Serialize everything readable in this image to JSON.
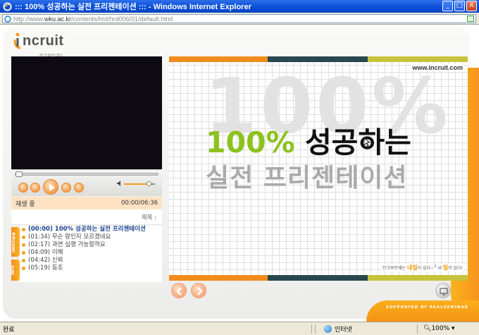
{
  "window": {
    "title": ":::  100% 성공하는 실전 프리젠테이션  ::: - Windows Internet Explorer",
    "buttons": [
      "_",
      "□",
      "X"
    ]
  },
  "address": {
    "prefix": "http://www.",
    "host": "wku.ac.kr",
    "path": "/contents/hrd/hrd006/01/default.html"
  },
  "logo": {
    "word": "ncruit",
    "sub": "인크루트(주)"
  },
  "player": {
    "status_label": "재생 중",
    "time": "00:00/06:36",
    "title_label": "제목 :",
    "seek_fraction": 0.0,
    "volume_fraction": 0.8,
    "tabs": [
      "INDEX/목록",
      "INFO"
    ],
    "index": [
      {
        "text": "(00:00) 100% 성공하는 실전 프리젠테이션",
        "active": true
      },
      {
        "text": "(01:34) 무슨 말인지 모르겠네요",
        "active": false
      },
      {
        "text": "(02:17) 과연 실행 가능할까요",
        "active": false
      },
      {
        "text": "(04:09) 이해",
        "active": false
      },
      {
        "text": "(04:42) 신뢰",
        "active": false
      },
      {
        "text": "(05:19) 동조",
        "active": false
      }
    ]
  },
  "slide": {
    "url": "www.incruit.com",
    "bg_number": "100%",
    "headline_pct": "100%",
    "headline_rest": " 성공하는",
    "subline": "실전 프리젠테이션",
    "tagline_pre": "인크루트에는 ",
    "tagline_hl1": "내일",
    "tagline_mid": "이 있다~",
    "tagline_sup": "2",
    "tagline_mid2": " 내 ",
    "tagline_hl2": "일",
    "tagline_end": "이 있다!",
    "bar_colors": [
      "#f08c1b",
      "#28474e",
      "#c8c33c"
    ]
  },
  "footer": {
    "supported": "SUPPORTED BY REALSEMINAR"
  },
  "statusbar": {
    "done": "완료",
    "zone": "인터넷",
    "zoom": "100%"
  }
}
